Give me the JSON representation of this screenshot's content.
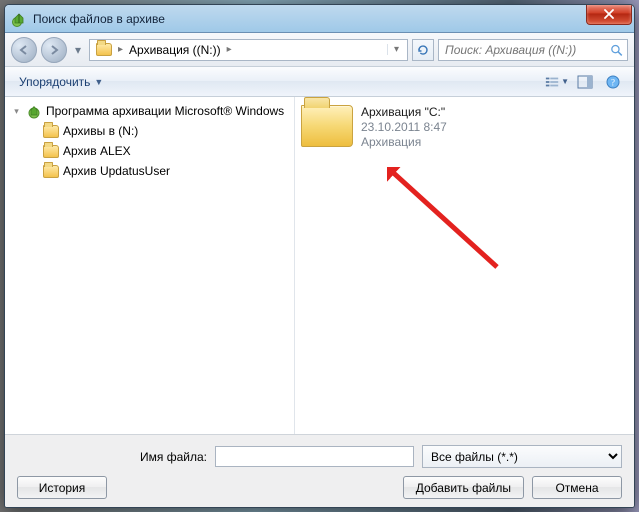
{
  "window": {
    "title": "Поиск файлов в архиве"
  },
  "address": {
    "seg1": "Архивация ((N:))"
  },
  "search": {
    "placeholder": "Поиск: Архивация ((N:))"
  },
  "toolbar": {
    "organize": "Упорядочить"
  },
  "tree": {
    "root": "Программа архивации Microsoft® Windows",
    "nodes": [
      "Архивы в (N:)",
      "Архив ALEX",
      "Архив UpdatusUser"
    ]
  },
  "list": {
    "item": {
      "name": "Архивация \"C:\"",
      "date": "23.10.2011 8:47",
      "kind": "Архивация"
    }
  },
  "footer": {
    "filename_label": "Имя файла:",
    "filename_value": "",
    "filter_label": "Все файлы (*.*)",
    "add_files": "Добавить файлы",
    "cancel": "Отмена",
    "history": "История"
  }
}
